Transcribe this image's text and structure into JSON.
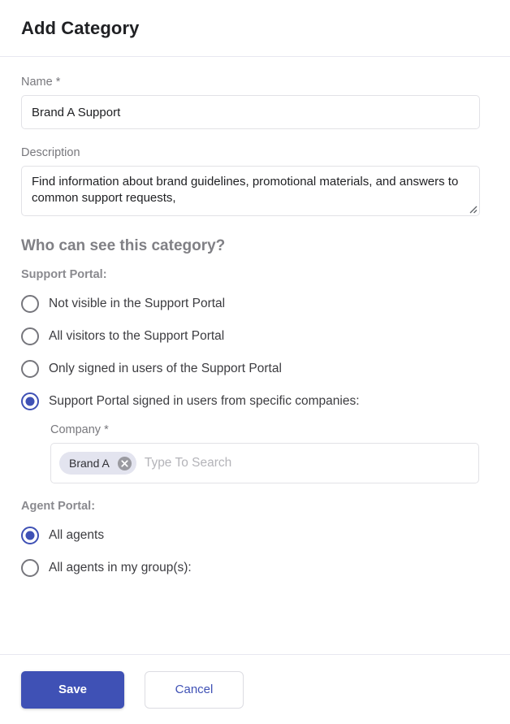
{
  "dialog": {
    "title": "Add Category"
  },
  "form": {
    "name": {
      "label": "Name *",
      "value": "Brand A Support",
      "placeholder": ""
    },
    "description": {
      "label": "Description",
      "value": "Find information about brand guidelines, promotional materials, and answers to common support requests,",
      "placeholder": ""
    }
  },
  "visibility": {
    "heading": "Who can see this category?",
    "support_portal": {
      "label": "Support Portal:",
      "options": [
        {
          "label": "Not visible in the Support Portal",
          "selected": false
        },
        {
          "label": "All visitors to the Support Portal",
          "selected": false
        },
        {
          "label": "Only signed in users of the Support Portal",
          "selected": false
        },
        {
          "label": "Support Portal signed in users from specific companies:",
          "selected": true
        }
      ]
    },
    "company": {
      "label": "Company *",
      "chips": [
        {
          "text": "Brand A",
          "remove_icon": "close-circle-icon"
        }
      ],
      "search_placeholder": "Type To Search",
      "search_value": ""
    },
    "agent_portal": {
      "label": "Agent Portal:",
      "options": [
        {
          "label": "All agents",
          "selected": true
        },
        {
          "label": "All agents in my group(s):",
          "selected": false
        }
      ]
    }
  },
  "footer": {
    "save_label": "Save",
    "cancel_label": "Cancel"
  },
  "colors": {
    "accent": "#3f51b5",
    "chip_bg": "#e3e4ef",
    "border": "#e2e2e6",
    "muted_text": "#78787d"
  }
}
